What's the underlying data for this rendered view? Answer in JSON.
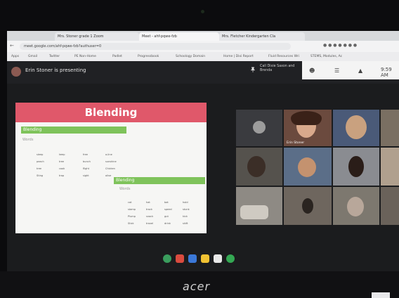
{
  "browser": {
    "tabs": [
      {
        "label": "Mrs. Stoner grade 1 Zoom"
      },
      {
        "label": "Meet - ahf-pqwe-fzb"
      },
      {
        "label": "Mrs. Fletcher Kindergarten Cla"
      }
    ],
    "url": "meet.google.com/ahf-pqwe-fzb?authuser=0",
    "bookmarks": [
      "Apps",
      "Gmail",
      "Twitter",
      "PE Non-Home",
      "Padlet",
      "Progressbook",
      "Schoology Domain",
      "Home | Dixi Report",
      "Fluid Resources Wri",
      "STEMS, Modules, Ac"
    ]
  },
  "meet": {
    "presenter_text": "Erin Stoner is presenting",
    "call_note": "Call Dixie Saxon and Brenda",
    "time": "9:59 AM"
  },
  "slide": {
    "title": "Blending",
    "bar1": "Blending",
    "sub1": "Words",
    "bar2": "Blending",
    "sub2": "Words",
    "words_left": [
      "sleep",
      "keep",
      "free",
      "a-line",
      "peach",
      "tree",
      "bunch",
      "sunshine",
      "tree",
      "cook",
      "flight",
      "Chicken",
      "Sting",
      "trap",
      "sight",
      "olive"
    ],
    "words_right": [
      "cat",
      "hat",
      "bat",
      "hold",
      "stamp",
      "track",
      "speed",
      "stunk",
      "Plump",
      "snack",
      "gut",
      "kick",
      "Stick",
      "travel",
      "drink",
      "shift"
    ]
  },
  "participants": [
    {
      "name": "Erin Stoner"
    }
  ],
  "laptop": {
    "brand": "acer"
  }
}
